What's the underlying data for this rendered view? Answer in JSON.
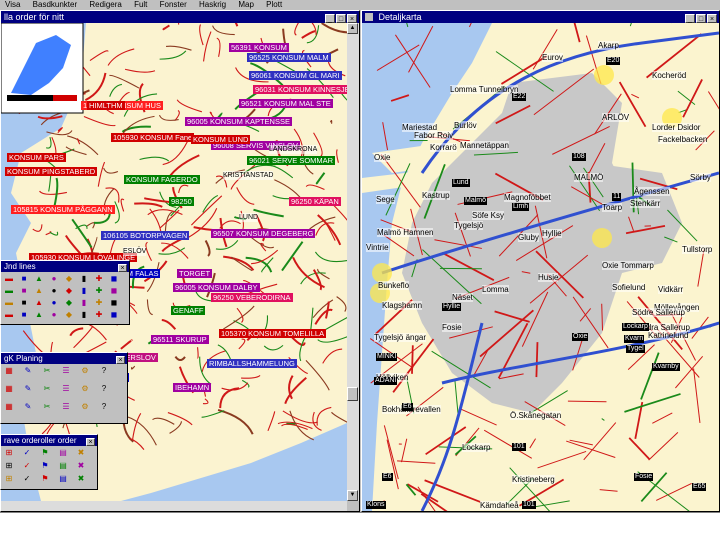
{
  "menu": [
    "Visa",
    "Basdkunkter",
    "Redigera",
    "Fult",
    "Fonster",
    "Haskrig",
    "Map",
    "Plott"
  ],
  "left_window": {
    "title": "lla order för nitt",
    "order_labels": [
      {
        "text": "56391 KONSUM",
        "color": "#a000a0"
      },
      {
        "text": "96525 KONSUM MALM",
        "color": "#3030c0"
      },
      {
        "text": "96061 KONSUM GL MARI",
        "color": "#3030c0"
      },
      {
        "text": "96031 KONSUM KINNESJE",
        "color": "#e01060"
      },
      {
        "text": "96521 KONSUM MAL STE",
        "color": "#a000a0"
      },
      {
        "text": "105991 KONSUM HUS",
        "color": "#ff2020"
      },
      {
        "text": "96005 KONSUM KAPTENSSE",
        "color": "#a000a0"
      },
      {
        "text": "105930 KONSUM Fane",
        "color": "#d00000"
      },
      {
        "text": "96008 SERVIS VINSLOV",
        "color": "#a000a0"
      },
      {
        "text": "96021 SERVE SOMMAR",
        "color": "#008000"
      },
      {
        "text": "KONSUM PARS",
        "color": "#d00000"
      },
      {
        "text": "KONSUM PINGSTABERD",
        "color": "#d00000"
      },
      {
        "text": "KONSUM FAGERDO",
        "color": "#008000"
      },
      {
        "text": "105815 KONSUM PÅGGANN",
        "color": "#ff2020"
      },
      {
        "text": "96250 KÄPAN",
        "color": "#e01060"
      },
      {
        "text": "106105 BOTORPVAGEN",
        "color": "#3030c0"
      },
      {
        "text": "96507 KONSUM DEGEBERG",
        "color": "#a000a0"
      },
      {
        "text": "105930 KONSUM LÖVALINGE",
        "color": "#d00000"
      },
      {
        "text": "105919 KONSUM FALAS",
        "color": "#0000c0"
      },
      {
        "text": "TORGET",
        "color": "#a000a0"
      },
      {
        "text": "96005 KONSUM DALBY",
        "color": "#a000a0"
      },
      {
        "text": "96250 VEBERODIRNA",
        "color": "#e01060"
      },
      {
        "text": "105370 KONSUM TOMELILLA",
        "color": "#d00000"
      },
      {
        "text": "GENAFF",
        "color": "#008000"
      },
      {
        "text": "96511 SKURUP",
        "color": "#a000a0"
      },
      {
        "text": "KONSUM ANDERSLOV",
        "color": "#c01080"
      },
      {
        "text": "RIMBALLSHAMMELUNG",
        "color": "#3030c0"
      },
      {
        "text": "KONSUM HÖGÅS",
        "color": "#0000c0"
      },
      {
        "text": "IBEHAMN",
        "color": "#a000a0"
      },
      {
        "text": "KONSUM LUND",
        "color": "#d00000"
      },
      {
        "text": "HIMLTHM",
        "color": "#d00000"
      },
      {
        "text": "98250",
        "color": "#008000"
      }
    ],
    "place_labels": [
      "KRISTIANSTAD",
      "LANDSKRONA",
      "ESLÖV",
      "LUND"
    ]
  },
  "right_window": {
    "title": "Detaljkarta",
    "places": [
      "Eurov",
      "Kocheröd",
      "Akarp",
      "Lomma Tunnelbryn",
      "Mariestad",
      "Burlöv",
      "ARLÖV",
      "Fabor Roiv",
      "Mannetäppan",
      "Lorder Dsidor",
      "Fackelbacken",
      "Korrarö",
      "Magnoföbbet",
      "Oxie",
      "MALMÖ",
      "Kastrup",
      "Ågenssen",
      "Sege",
      "Söfe Ksy",
      "Malmö Hamnen",
      "Tygelsjö",
      "Lomma",
      "Näset",
      "Fosie",
      "Hyllie",
      "Gluby",
      "Vintrie",
      "Bunkeflo",
      "Klagshamn",
      "Tygelsjö ängar",
      "Bokhållarevallen",
      "Ö.Skånegatan",
      "Lockarp",
      "Kristineberg",
      "Kämdaheå",
      "Höllviken",
      "Husie",
      "Oxie Tommarp",
      "Sofielund",
      "Möllevången",
      "Vidkärr",
      "Stenkärr",
      "Tullstorp",
      "Sörby",
      "Toarp",
      "Södre Sallerup",
      "Södra Sallerup",
      "Katrinelund"
    ],
    "road_signs": [
      "E6",
      "E65",
      "E22",
      "108",
      "101",
      "11",
      "E20",
      "E6",
      "Kvarn",
      "Klons",
      "ADANI",
      "MINKI",
      "Lund",
      "Malmö",
      "Limh",
      "Hyllie",
      "Oxie",
      "Kvarnby",
      "Lockarp",
      "Tygel",
      "Fosie",
      "101"
    ]
  },
  "tool_windows": {
    "t1_title": "Jnd lines",
    "t2_title": "gK Planing",
    "t3_title": "rave orderoller order"
  },
  "status": {
    "text": ""
  }
}
